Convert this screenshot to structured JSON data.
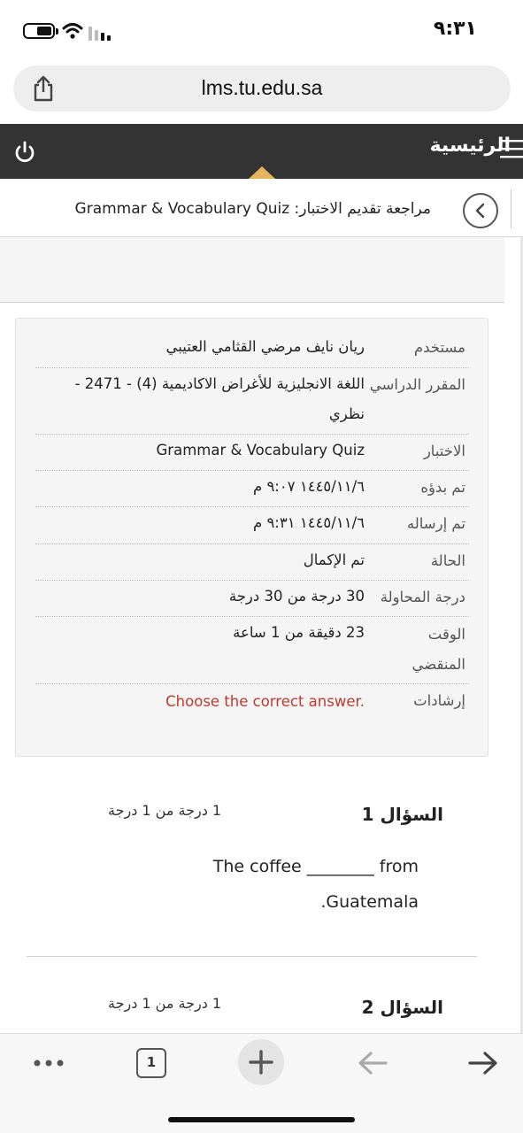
{
  "status_bar": {
    "time": "٩:٣١"
  },
  "browser": {
    "url": "lms.tu.edu.sa",
    "open_tabs": "1"
  },
  "nav": {
    "home_label": "الرئيسية"
  },
  "breadcrumb": {
    "text": "مراجعة تقديم الاختبار: Grammar & Vocabulary Quiz"
  },
  "summary": {
    "rows": [
      {
        "label": "مستخدم",
        "value": "ريان نايف مرضي القثامي العتيبي"
      },
      {
        "label": "المقرر الدراسي",
        "value": "اللغة الانجليزية للأغراض الاكاديمية (4) - 2471 - نظري"
      },
      {
        "label": "الاختبار",
        "value": "Grammar & Vocabulary Quiz"
      },
      {
        "label": "تم بدؤه",
        "value": "١٤٤٥/١١/٦ ٩:٠٧ م"
      },
      {
        "label": "تم إرساله",
        "value": "١٤٤٥/١١/٦ ٩:٣١ م"
      },
      {
        "label": "الحالة",
        "value": "تم الإكمال"
      },
      {
        "label": "درجة المحاولة",
        "value": "30 درجة من 30 درجة"
      },
      {
        "label": "الوقت المنقضي",
        "value": "23 دقيقة من 1 ساعة"
      },
      {
        "label": "إرشادات",
        "value": "Choose the correct answer."
      }
    ]
  },
  "questions": [
    {
      "title": "السؤال 1",
      "grade": "1 درجة من 1 درجة",
      "text_line1": "The coffee ________ from",
      "text_line2": ".Guatemala"
    },
    {
      "title": "السؤال 2",
      "grade": "1 درجة من 1 درجة"
    }
  ],
  "colors": {
    "header_bg": "#333333",
    "accent_caret": "#e6b75a",
    "instruction_red": "#c0392b"
  }
}
